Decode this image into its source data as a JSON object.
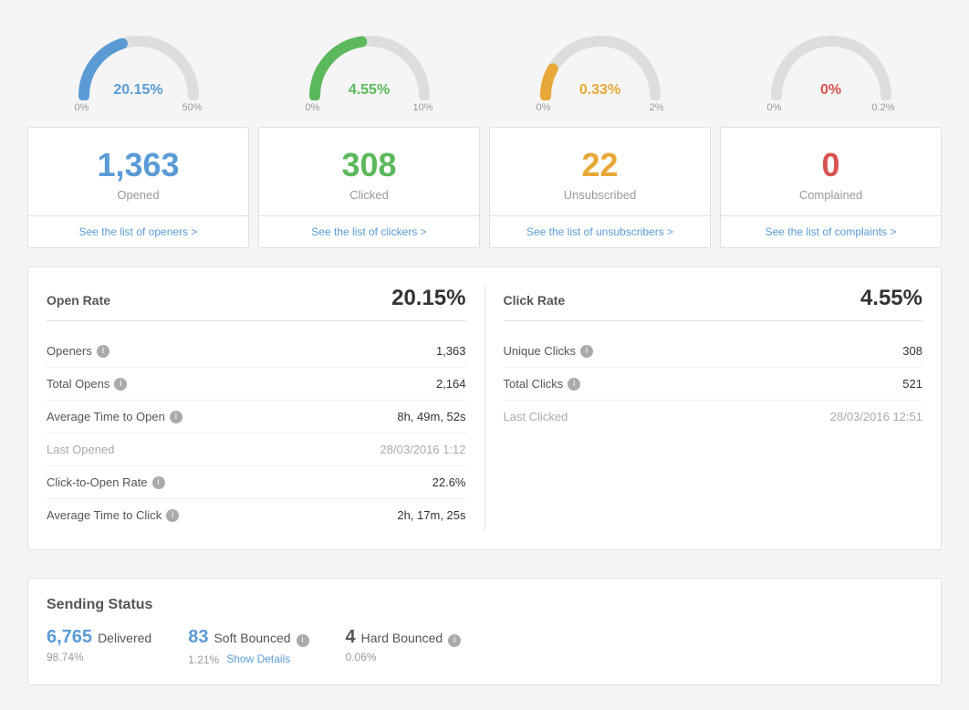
{
  "gauges": [
    {
      "id": "open-rate-gauge",
      "value": "20.15%",
      "color": "#5b9bd5",
      "min": "0%",
      "max": "50%",
      "startAngle": -180,
      "fillPercent": 0.403,
      "trackColor": "#ddd"
    },
    {
      "id": "click-rate-gauge",
      "value": "4.55%",
      "color": "#5cb85c",
      "min": "0%",
      "max": "10%",
      "fillPercent": 0.455,
      "trackColor": "#ddd"
    },
    {
      "id": "unsub-rate-gauge",
      "value": "0.33%",
      "color": "#e8a838",
      "min": "0%",
      "max": "2%",
      "fillPercent": 0.165,
      "trackColor": "#ddd"
    },
    {
      "id": "complaint-rate-gauge",
      "value": "0%",
      "color": "#d9534f",
      "min": "0%",
      "max": "0.2%",
      "fillPercent": 0,
      "trackColor": "#ddd"
    }
  ],
  "cards": [
    {
      "id": "opened-card",
      "number": "1,363",
      "label": "Opened",
      "link": "See the list of openers >",
      "numberColor": "#5b9bd5"
    },
    {
      "id": "clicked-card",
      "number": "308",
      "label": "Clicked",
      "link": "See the list of clickers >",
      "numberColor": "#5cb85c"
    },
    {
      "id": "unsubscribed-card",
      "number": "22",
      "label": "Unsubscribed",
      "link": "See the list of unsubscribers >",
      "numberColor": "#e8a838"
    },
    {
      "id": "complained-card",
      "number": "0",
      "label": "Complained",
      "link": "See the list of complaints >",
      "numberColor": "#d9534f"
    }
  ],
  "openStats": {
    "headerLabel": "Open Rate",
    "headerValue": "20.15%",
    "rows": [
      {
        "label": "Openers",
        "value": "1,363",
        "hasInfo": true,
        "muted": false
      },
      {
        "label": "Total Opens",
        "value": "2,164",
        "hasInfo": true,
        "muted": false
      },
      {
        "label": "Average Time to Open",
        "value": "8h, 49m, 52s",
        "hasInfo": true,
        "muted": false
      },
      {
        "label": "Last Opened",
        "value": "28/03/2016 1:12",
        "hasInfo": false,
        "muted": true
      },
      {
        "label": "Click-to-Open Rate",
        "value": "22.6%",
        "hasInfo": true,
        "muted": false
      },
      {
        "label": "Average Time to Click",
        "value": "2h, 17m, 25s",
        "hasInfo": true,
        "muted": false
      }
    ]
  },
  "clickStats": {
    "headerLabel": "Click Rate",
    "headerValue": "4.55%",
    "rows": [
      {
        "label": "Unique Clicks",
        "value": "308",
        "hasInfo": true,
        "muted": false
      },
      {
        "label": "Total Clicks",
        "value": "521",
        "hasInfo": true,
        "muted": false
      },
      {
        "label": "Last Clicked",
        "value": "28/03/2016 12:51",
        "hasInfo": false,
        "muted": true
      }
    ]
  },
  "sendingStatus": {
    "title": "Sending Status",
    "delivered": {
      "number": "6,765",
      "label": "Delivered",
      "pct": "98.74%",
      "numberColor": "#5b9bd5"
    },
    "softBounced": {
      "number": "83",
      "label": "Soft Bounced",
      "pct": "1.21%",
      "hasInfo": true,
      "hasShowDetails": true,
      "showDetailsLabel": "Show Details",
      "numberColor": "#5b9bd5"
    },
    "hardBounced": {
      "number": "4",
      "label": "Hard Bounced",
      "pct": "0.06%",
      "hasInfo": true,
      "numberColor": "#555"
    }
  },
  "infoIcon": "i"
}
